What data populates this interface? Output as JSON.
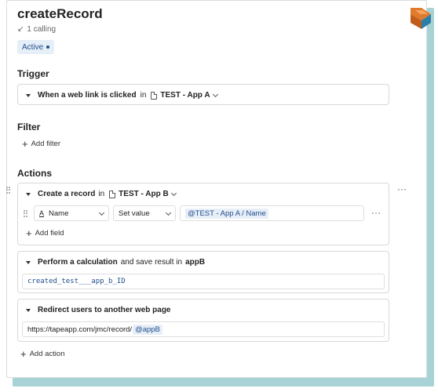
{
  "header": {
    "title": "createRecord",
    "calling_text": "1 calling",
    "status_label": "Active"
  },
  "trigger": {
    "heading": "Trigger",
    "event_label": "When a web link is clicked",
    "in_word": "in",
    "app_label": "TEST - App A"
  },
  "filter": {
    "heading": "Filter",
    "add_label": "Add filter"
  },
  "actions": {
    "heading": "Actions",
    "create_record": {
      "label": "Create a record",
      "in_word": "in",
      "app_label": "TEST - App B",
      "field_name": "Name",
      "operation": "Set value",
      "value_token": "@TEST - App A / Name",
      "add_field_label": "Add field"
    },
    "calculation": {
      "label_bold": "Perform a calculation",
      "label_mid": "and save result in",
      "result_name": "appB",
      "expression": "created_test___app_b_ID"
    },
    "redirect": {
      "label": "Redirect users to another web page",
      "url_text": "https://tapeapp.com/jmc/record/",
      "url_token": "@appB"
    },
    "add_action_label": "Add action"
  }
}
